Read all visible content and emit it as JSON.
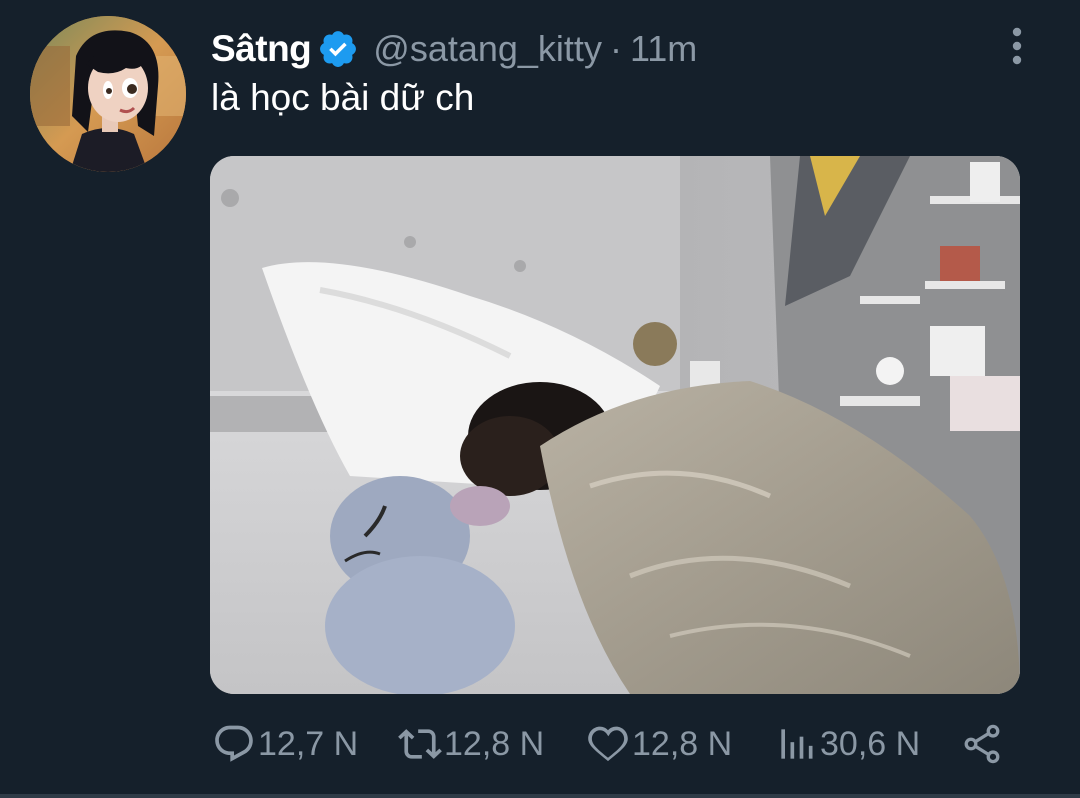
{
  "tweet": {
    "author": {
      "display_name": "Sâtng",
      "verified": true,
      "handle": "@satang_kitty",
      "separator": "·",
      "time": "11m",
      "avatar": "avatar-cartoon-girl"
    },
    "text": "là học bài dữ ch",
    "media": {
      "type": "photo",
      "subject": "photo-sleeping-under-blanket"
    },
    "actions": {
      "reply": {
        "icon": "reply-icon",
        "count": "12,7 N"
      },
      "retweet": {
        "icon": "retweet-icon",
        "count": "12,8 N"
      },
      "like": {
        "icon": "heart-icon",
        "count": "12,8 N"
      },
      "views": {
        "icon": "views-icon",
        "count": "30,6 N"
      },
      "share": {
        "icon": "share-icon"
      }
    },
    "more_icon": "more-vertical-icon"
  },
  "colors": {
    "background": "#15202b",
    "text_primary": "#ffffff",
    "text_secondary": "#8b98a5",
    "verified": "#1d9bf0"
  }
}
